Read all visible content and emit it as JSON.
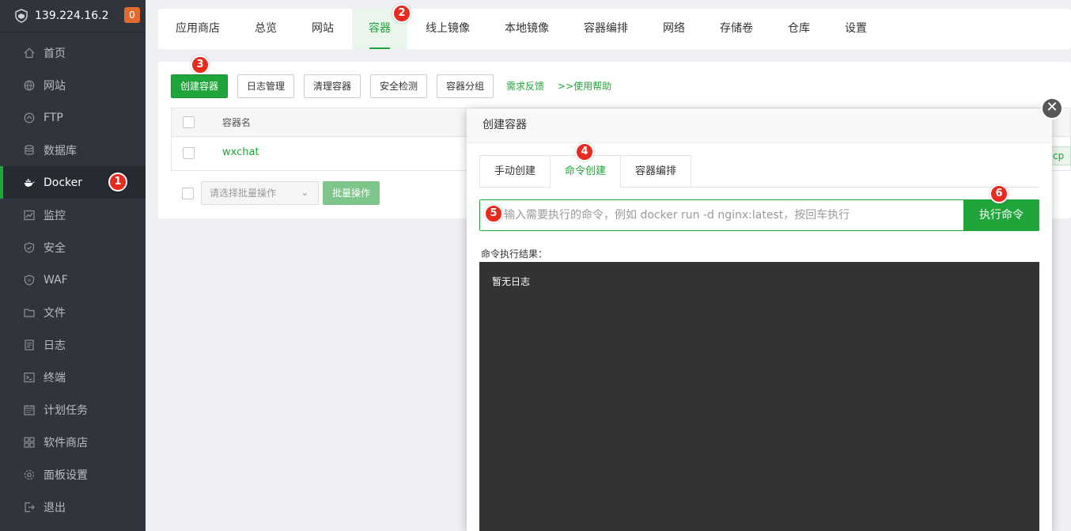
{
  "sidebar": {
    "server": "139.224.16.2",
    "badge": "0",
    "items": [
      {
        "label": "首页",
        "icon": "home-icon"
      },
      {
        "label": "网站",
        "icon": "globe-icon"
      },
      {
        "label": "FTP",
        "icon": "ftp-icon"
      },
      {
        "label": "数据库",
        "icon": "database-icon"
      },
      {
        "label": "Docker",
        "icon": "docker-icon"
      },
      {
        "label": "监控",
        "icon": "monitor-icon"
      },
      {
        "label": "安全",
        "icon": "shield-icon"
      },
      {
        "label": "WAF",
        "icon": "waf-icon"
      },
      {
        "label": "文件",
        "icon": "folder-icon"
      },
      {
        "label": "日志",
        "icon": "log-icon"
      },
      {
        "label": "终端",
        "icon": "terminal-icon"
      },
      {
        "label": "计划任务",
        "icon": "calendar-icon"
      },
      {
        "label": "软件商店",
        "icon": "apps-icon"
      },
      {
        "label": "面板设置",
        "icon": "gear-icon"
      },
      {
        "label": "退出",
        "icon": "logout-icon"
      }
    ]
  },
  "top_tabs": [
    "应用商店",
    "总览",
    "网站",
    "容器",
    "线上镜像",
    "本地镜像",
    "容器编排",
    "网络",
    "存储卷",
    "仓库",
    "设置"
  ],
  "toolbar": {
    "create": "创建容器",
    "log": "日志管理",
    "clean": "清理容器",
    "security": "安全检测",
    "group": "容器分组",
    "feedback": "需求反馈",
    "help": ">>使用帮助"
  },
  "table": {
    "col_name": "容器名",
    "rows": [
      {
        "name": "wxchat",
        "port_fragment": "cp"
      }
    ]
  },
  "batch": {
    "placeholder": "请选择批量操作",
    "button": "批量操作"
  },
  "modal": {
    "title": "创建容器",
    "tabs": [
      "手动创建",
      "命令创建",
      "容器编排"
    ],
    "input_placeholder": "输入需要执行的命令，例如 docker run -d nginx:latest，按回车执行",
    "run_button": "执行命令",
    "result_label": "命令执行结果：",
    "result_text": "暂无日志"
  },
  "markers": [
    "1",
    "2",
    "3",
    "4",
    "5",
    "6"
  ],
  "colors": {
    "accent": "#20a53a",
    "sidebar_bg": "#30353d",
    "marker": "#e82a1f",
    "badge": "#e06b2d"
  }
}
